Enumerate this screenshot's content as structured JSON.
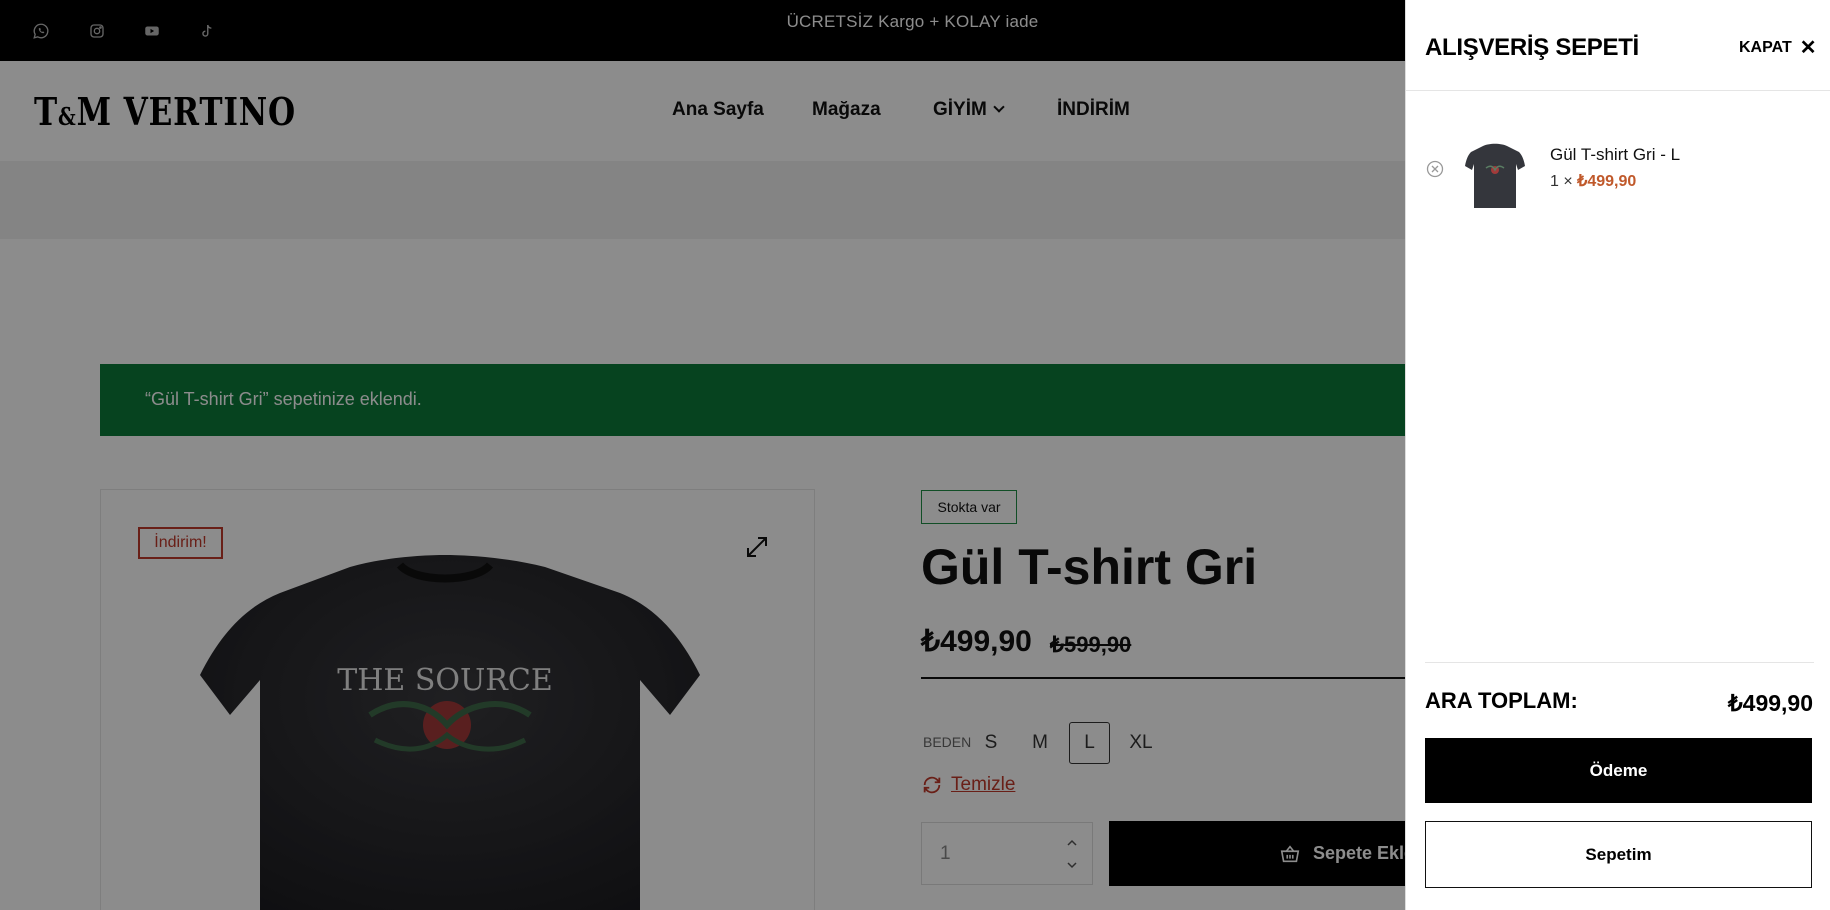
{
  "topbar": {
    "promo": "ÜCRETSİZ Kargo + KOLAY iade",
    "social_icons": [
      "whatsapp-icon",
      "instagram-icon",
      "youtube-icon",
      "tiktok-icon"
    ]
  },
  "header": {
    "logo_left": "T",
    "logo_amp": "&",
    "logo_right": "M VERTINO",
    "nav": [
      "Ana Sayfa",
      "Mağaza",
      "GİYİM",
      "İNDİRİM"
    ]
  },
  "notice": {
    "text": "“Gül T-shirt Gri” sepetinize eklendi."
  },
  "product": {
    "sale_badge": "İndirim!",
    "stock": "Stokta var",
    "title": "Gül T-shirt Gri",
    "price": "₺499,90",
    "old_price": "₺599,90",
    "print_text": "THE SOURCE",
    "size_label": "BEDEN",
    "sizes": [
      "S",
      "M",
      "L",
      "XL"
    ],
    "selected_size": "L",
    "clear_label": "Temizle",
    "quantity": "1",
    "add_to_cart": "Sepete Ekle"
  },
  "cart": {
    "title": "ALIŞVERİŞ SEPETİ",
    "close_label": "KAPAT",
    "item": {
      "name": "Gül T-shirt Gri - L",
      "qty_prefix": "1 ×",
      "price": "₺499,90"
    },
    "subtotal_label": "ARA TOPLAM:",
    "subtotal_value": "₺499,90",
    "checkout_label": "Ödeme",
    "view_cart_label": "Sepetim"
  },
  "colors": {
    "accent": "#c0392b",
    "success": "#0b7a3a",
    "overlay": "rgba(0,0,0,0.45)"
  }
}
